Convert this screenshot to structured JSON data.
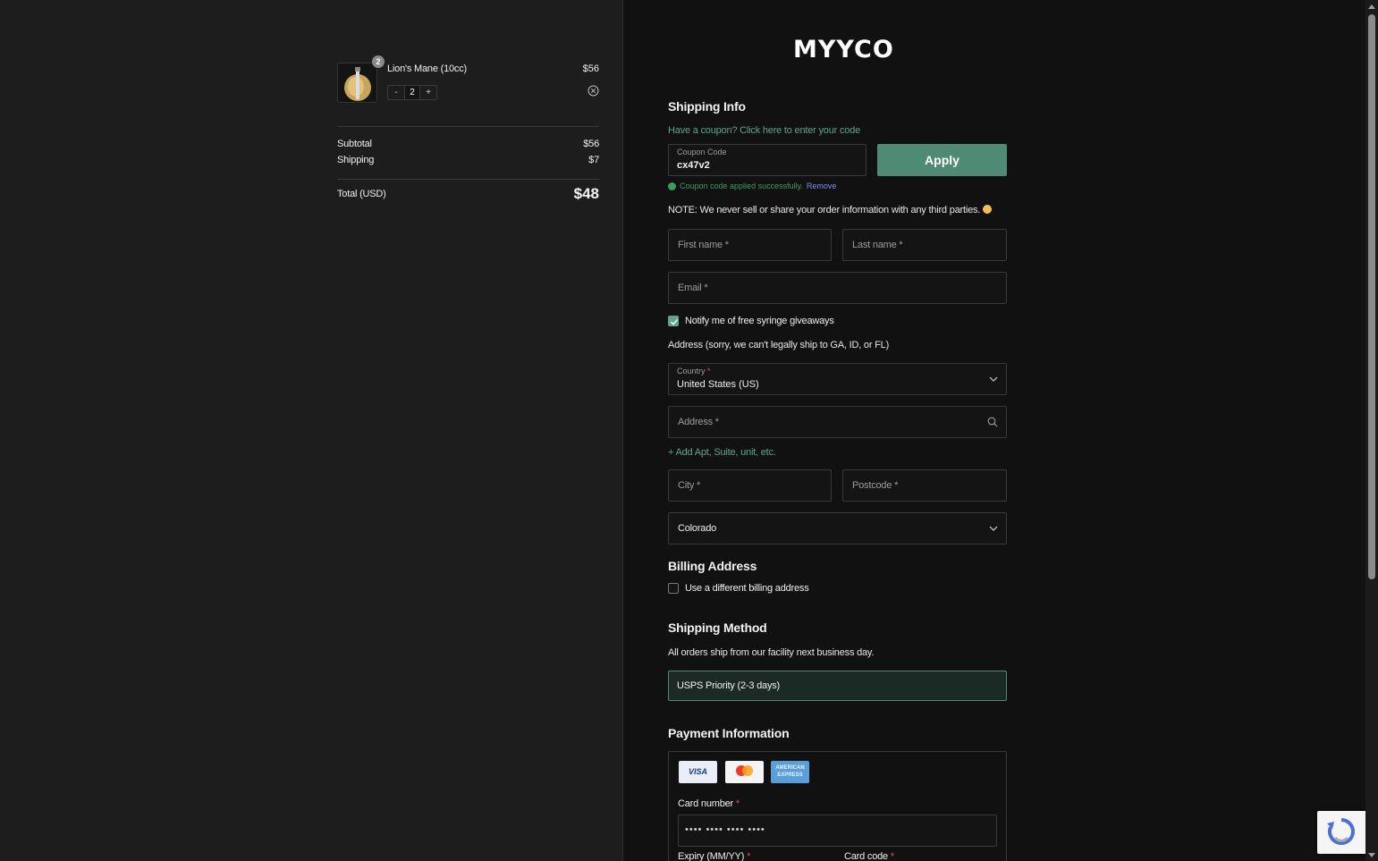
{
  "summary": {
    "item": {
      "name": "Lion's Mane (10cc)",
      "price": "$56",
      "badge_qty": "2",
      "qty": "2",
      "minus": "-",
      "plus": "+"
    },
    "subtotal_label": "Subtotal",
    "subtotal_value": "$56",
    "shipping_label": "Shipping",
    "shipping_value": "$7",
    "total_label": "Total (USD)",
    "total_value": "$48"
  },
  "brand": {
    "logo": "MYYCO"
  },
  "shipping_info": {
    "title": "Shipping Info",
    "coupon_prompt": "Have a coupon? Click here to enter your code",
    "coupon_label": "Coupon Code",
    "coupon_value": "cx47v2",
    "apply_label": "Apply",
    "coupon_success": "Coupon code applied successfully.",
    "coupon_remove": "Remove",
    "note": "NOTE: We never sell or share your order information with any third parties."
  },
  "form": {
    "first_name": "First name *",
    "last_name": "Last name *",
    "email": "Email *",
    "notify_label": "Notify me of free syringe giveaways",
    "notify_checked": true,
    "address_note": "Address (sorry, we can't legally ship to GA, ID, or FL)",
    "country_label": "Country",
    "country_required": "*",
    "country_value": "United States (US)",
    "address": "Address *",
    "add_apt": "+ Add Apt, Suite, unit, etc.",
    "city": "City *",
    "postcode": "Postcode *",
    "state_value": "Colorado"
  },
  "billing": {
    "title": "Billing Address",
    "different_label": "Use a different billing address",
    "different_checked": false
  },
  "shipping_method": {
    "title": "Shipping Method",
    "note": "All orders ship from our facility next business day.",
    "option": "USPS Priority (2-3 days)"
  },
  "payment": {
    "title": "Payment Information",
    "cards": [
      "VISA",
      "mastercard",
      "AMERICAN EXPRESS"
    ],
    "card_number_label": "Card number",
    "card_number_placeholder": "•••• •••• •••• ••••",
    "expiry_label": "Expiry (MM/YY)",
    "card_code_label": "Card code",
    "required_mark": "*"
  },
  "colors": {
    "accent": "#4f8a74",
    "accent_text": "#5ea58c",
    "success": "#3c9a64",
    "left_bg": "#1d1d1d",
    "right_bg": "#111111"
  }
}
